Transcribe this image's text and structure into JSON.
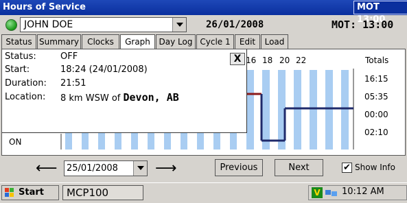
{
  "window": {
    "title": "Hours of Service",
    "badge": "MOT 13:00"
  },
  "header": {
    "driver": "JOHN DOE",
    "date": "26/01/2008",
    "mot": "MOT: 13:00"
  },
  "tabs": [
    "Status",
    "Summary",
    "Clocks",
    "Graph",
    "Day Log",
    "Cycle 1",
    "Edit",
    "Load"
  ],
  "active_tab": "Graph",
  "info_popup": {
    "status_label": "Status:",
    "status_value": "OFF",
    "start_label": "Start:",
    "start_value": "18:24 (24/01/2008)",
    "duration_label": "Duration:",
    "duration_value": "21:51",
    "location_label": "Location:",
    "location_prefix": "8 km WSW of ",
    "location_city": "Devon, AB",
    "close_glyph": "X"
  },
  "graph": {
    "visible_hour_labels": [
      "16",
      "18",
      "20",
      "22"
    ],
    "row_label_on": "ON",
    "totals_label": "Totals",
    "totals": [
      "16:15",
      "05:35",
      "00:00",
      "02:10"
    ],
    "line_color": "#1f2a6b",
    "off_segment_color": "#8b1a1a",
    "stripe_color": "#a9cdf2"
  },
  "controls": {
    "prev_arrow": "⟵",
    "next_arrow": "⟶",
    "date_value": "25/01/2008",
    "previous_label": "Previous",
    "next_label": "Next",
    "show_info_label": "Show Info",
    "show_info_checked": true
  },
  "taskbar": {
    "start_label": "Start",
    "app_label": "MCP100",
    "clock": "10:12 AM"
  }
}
